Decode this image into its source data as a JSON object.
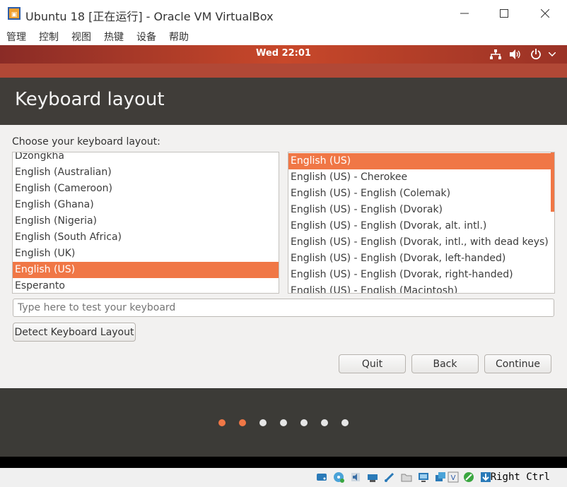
{
  "window": {
    "title": "Ubuntu 18 [正在运行] - Oracle VM VirtualBox",
    "menu": [
      "管理",
      "控制",
      "视图",
      "热键",
      "设备",
      "帮助"
    ]
  },
  "ubuntu_topbar": {
    "clock": "Wed 22:01",
    "icons": [
      "network-icon",
      "volume-icon",
      "power-icon",
      "chevron-down-icon"
    ]
  },
  "installer": {
    "title": "Keyboard layout",
    "prompt": "Choose your keyboard layout:",
    "layouts": [
      "Dzongkha",
      "English (Australian)",
      "English (Cameroon)",
      "English (Ghana)",
      "English (Nigeria)",
      "English (South Africa)",
      "English (UK)",
      "English (US)",
      "Esperanto"
    ],
    "selected_layout": "English (US)",
    "variants": [
      "English (US)",
      "English (US) - Cherokee",
      "English (US) - English (Colemak)",
      "English (US) - English (Dvorak)",
      "English (US) - English (Dvorak, alt. intl.)",
      "English (US) - English (Dvorak, intl., with dead keys)",
      "English (US) - English (Dvorak, left-handed)",
      "English (US) - English (Dvorak, right-handed)",
      "English (US) - English (Macintosh)"
    ],
    "selected_variant": "English (US)",
    "test_placeholder": "Type here to test your keyboard",
    "detect_button": "Detect Keyboard Layout",
    "quit_button": "Quit",
    "back_button": "Back",
    "continue_button": "Continue",
    "progress": {
      "total_steps": 7,
      "completed_steps": 2
    }
  },
  "statusbar": {
    "host_key": "Right Ctrl",
    "icons": [
      "hdd-icon",
      "optical-drive-icon",
      "audio-icon",
      "network-adapter-icon",
      "usb-icon",
      "shared-folders-icon",
      "display-icon",
      "recording-icon",
      "vt-x-icon",
      "mouse-integration-icon",
      "keyboard-capture-icon"
    ]
  },
  "colors": {
    "accent": "#f07746",
    "header": "#403d39",
    "footer": "#3c3b37"
  }
}
